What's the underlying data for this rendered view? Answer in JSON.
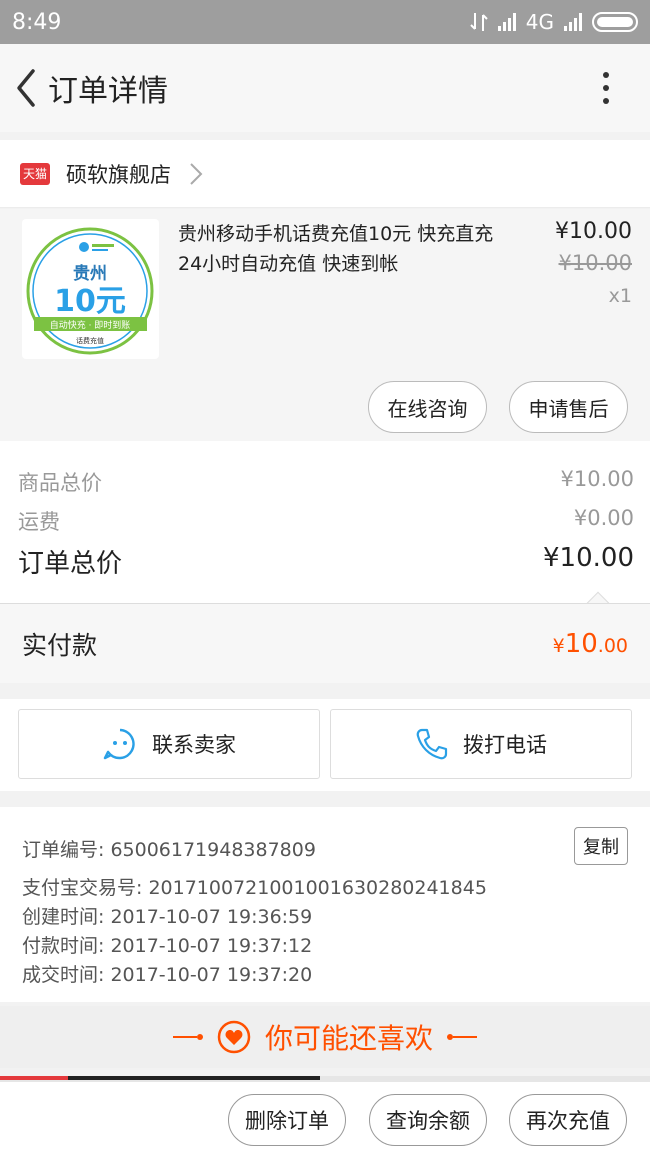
{
  "status_bar": {
    "time": "8:49",
    "network": "4G"
  },
  "header": {
    "title": "订单详情"
  },
  "store": {
    "badge": "天猫",
    "name": "硕软旗舰店"
  },
  "product": {
    "title": "贵州移动手机话费充值10元 快充直充 24小时自动充值 快速到帐",
    "price": "¥10.00",
    "original_price": "¥10.00",
    "quantity": "x1",
    "image": {
      "province": "贵州",
      "amount": "10元",
      "tagline": "自动快充 · 即时到账",
      "footer": "话费充值"
    },
    "actions": {
      "consult": "在线咨询",
      "after_sale": "申请售后"
    }
  },
  "totals": {
    "goods_label": "商品总价",
    "goods_value": "¥10.00",
    "shipping_label": "运费",
    "shipping_value": "¥0.00",
    "order_total_label": "订单总价",
    "order_total_value": "¥10.00"
  },
  "paid": {
    "label": "实付款",
    "currency": "¥",
    "integer": "10",
    "decimal": ".00"
  },
  "contact": {
    "seller": "联系卖家",
    "call": "拨打电话"
  },
  "order_info": {
    "order_no": "订单编号: 65006171948387809",
    "copy": "复制",
    "alipay_no": "支付宝交易号: 2017100721001001630280241845",
    "created": "创建时间: 2017-10-07 19:36:59",
    "paid_time": "付款时间: 2017-10-07 19:37:12",
    "closed_time": "成交时间: 2017-10-07 19:37:20"
  },
  "recommend": {
    "title": "你可能还喜欢"
  },
  "bottom_actions": {
    "delete": "删除订单",
    "balance": "查询余额",
    "recharge": "再次充值"
  },
  "colors": {
    "accent": "#ff5000",
    "tmall_red": "#e4393c",
    "icon_blue": "#2aa0e6"
  }
}
